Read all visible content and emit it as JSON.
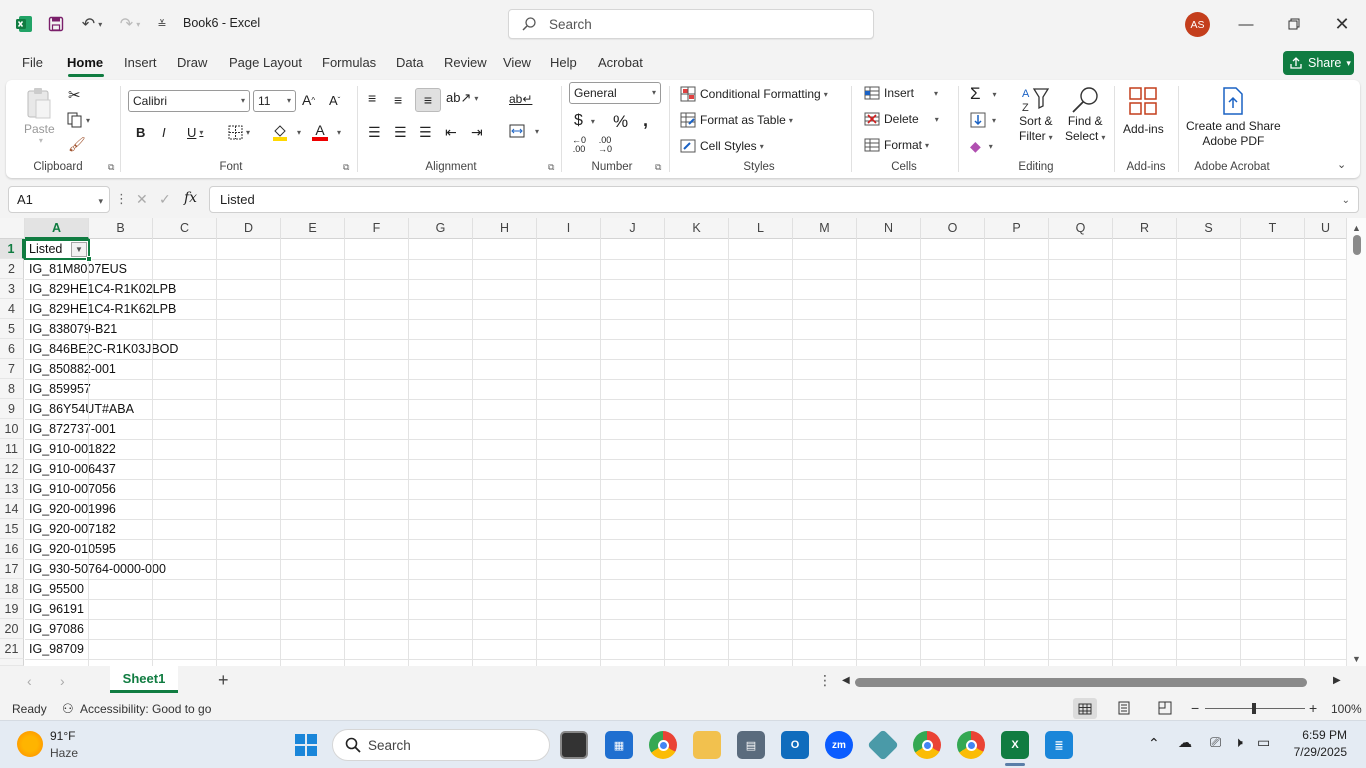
{
  "app": {
    "title": "Book6  -  Excel",
    "search_placeholder": "Search",
    "avatar_initials": "AS",
    "share_label": "Share"
  },
  "tabs": [
    "File",
    "Home",
    "Insert",
    "Draw",
    "Page Layout",
    "Formulas",
    "Data",
    "Review",
    "View",
    "Help",
    "Acrobat"
  ],
  "active_tab": "Home",
  "ribbon": {
    "groups": {
      "clipboard": "Clipboard",
      "font": "Font",
      "alignment": "Alignment",
      "number": "Number",
      "styles": "Styles",
      "cells": "Cells",
      "editing": "Editing",
      "addins": "Add-ins",
      "acrobat": "Adobe Acrobat"
    },
    "paste_label": "Paste",
    "font_name": "Calibri",
    "font_size": "11",
    "number_format": "General",
    "conditional_formatting": "Conditional Formatting",
    "format_as_table": "Format as Table",
    "cell_styles": "Cell Styles",
    "insert": "Insert",
    "delete": "Delete",
    "format": "Format",
    "sort_filter_1": "Sort &",
    "sort_filter_2": "Filter",
    "find_select_1": "Find &",
    "find_select_2": "Select",
    "addins_btn": "Add-ins",
    "create_pdf_1": "Create and Share",
    "create_pdf_2": "Adobe PDF",
    "bold": "B",
    "italic": "I",
    "underline": "U"
  },
  "formula_bar": {
    "name_box": "A1",
    "fx": "fx",
    "content": "Listed"
  },
  "columns": [
    "A",
    "B",
    "C",
    "D",
    "E",
    "F",
    "G",
    "H",
    "I",
    "J",
    "K",
    "L",
    "M",
    "N",
    "O",
    "P",
    "Q",
    "R",
    "S",
    "T",
    "U"
  ],
  "rows": [
    "Listed",
    "IG_81M8007EUS",
    "IG_829HE1C4-R1K02LPB",
    "IG_829HE1C4-R1K62LPB",
    "IG_838079-B21",
    "IG_846BE2C-R1K03JBOD",
    "IG_850882-001",
    "IG_859957",
    "IG_86Y54UT#ABA",
    "IG_872737-001",
    "IG_910-001822",
    "IG_910-006437",
    "IG_910-007056",
    "IG_920-001996",
    "IG_920-007182",
    "IG_920-010595",
    "IG_930-50764-0000-000",
    "IG_95500",
    "IG_96191",
    "IG_97086",
    "IG_98709"
  ],
  "row_numbers": [
    "1",
    "2",
    "3",
    "4",
    "5",
    "6",
    "7",
    "8",
    "9",
    "10",
    "11",
    "12",
    "13",
    "14",
    "15",
    "16",
    "17",
    "18",
    "19",
    "20",
    "21"
  ],
  "sheet_tab": "Sheet1",
  "status": {
    "ready": "Ready",
    "accessibility": "Accessibility: Good to go",
    "zoom": "100%"
  },
  "taskbar": {
    "weather_temp": "91°F",
    "weather_desc": "Haze",
    "search": "Search",
    "time": "6:59 PM",
    "date": "7/29/2025"
  },
  "colors": {
    "accent": "#107c41",
    "avatar": "#c43e1c"
  }
}
